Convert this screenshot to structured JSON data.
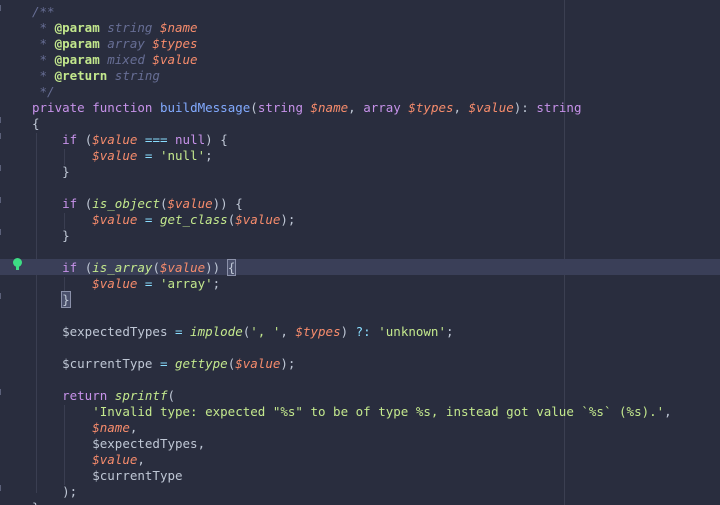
{
  "editor": {
    "breakpoint_line": 17,
    "current_line": 17
  },
  "code": {
    "l1": [
      "/**"
    ],
    "l2": [
      " * ",
      "@param",
      " string ",
      "$name"
    ],
    "l3": [
      " * ",
      "@param",
      " array ",
      "$types"
    ],
    "l4": [
      " * ",
      "@param",
      " mixed ",
      "$value"
    ],
    "l5": [
      " * ",
      "@return",
      " string"
    ],
    "l6": [
      " */"
    ],
    "l7": [
      "private",
      " ",
      "function",
      " ",
      "buildMessage",
      "(",
      "string",
      " ",
      "$name",
      ", ",
      "array",
      " ",
      "$types",
      ", ",
      "$value",
      "): ",
      "string"
    ],
    "l8": [
      "{"
    ],
    "l9": [
      "    ",
      "if",
      " (",
      "$value",
      " === ",
      "null",
      ") {"
    ],
    "l10": [
      "        ",
      "$value",
      " = ",
      "'null'",
      ";"
    ],
    "l11": [
      "    }"
    ],
    "l13": [
      "    ",
      "if",
      " (",
      "is_object",
      "(",
      "$value",
      ")) {"
    ],
    "l14": [
      "        ",
      "$value",
      " = ",
      "get_class",
      "(",
      "$value",
      ");"
    ],
    "l15": [
      "    }"
    ],
    "l17": [
      "    ",
      "if",
      " (",
      "is_array",
      "(",
      "$value",
      ")) ",
      "{"
    ],
    "l18": [
      "        ",
      "$value",
      " = ",
      "'array'",
      ";"
    ],
    "l19": [
      "    ",
      "}"
    ],
    "l21": [
      "    ",
      "$expectedTypes",
      " = ",
      "implode",
      "(",
      "', '",
      ", ",
      "$types",
      ") ",
      "?:",
      " ",
      "'unknown'",
      ";"
    ],
    "l23": [
      "    ",
      "$currentType",
      " = ",
      "gettype",
      "(",
      "$value",
      ");"
    ],
    "l25": [
      "    ",
      "return",
      " ",
      "sprintf",
      "("
    ],
    "l26": [
      "        ",
      "'Invalid type: expected \"%s\" to be of type %s, instead got value `%s` (%s).'",
      ","
    ],
    "l27": [
      "        ",
      "$name",
      ","
    ],
    "l28": [
      "        ",
      "$expectedTypes",
      ","
    ],
    "l29": [
      "        ",
      "$value",
      ","
    ],
    "l30": [
      "        ",
      "$currentType"
    ],
    "l31": [
      "    );"
    ],
    "l32": [
      "}"
    ]
  }
}
